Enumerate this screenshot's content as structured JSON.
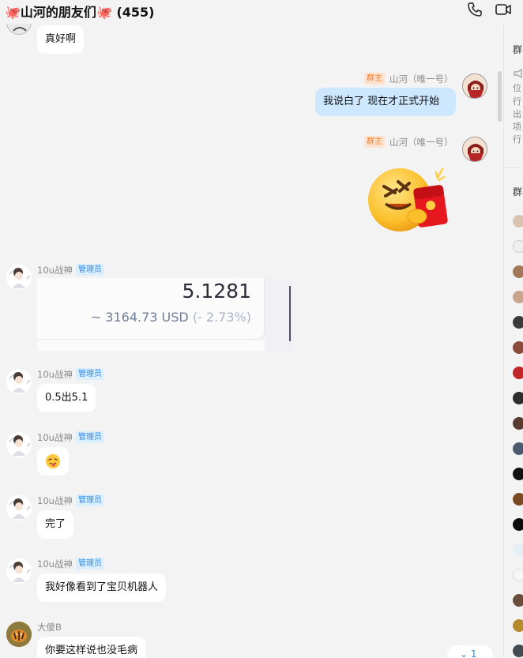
{
  "header": {
    "group_name": "山河的朋友们",
    "member_count": "(455)",
    "call_icon": "phone-icon",
    "video_icon": "video-icon"
  },
  "messages": [
    {
      "type": "text",
      "side": "left",
      "text": "真好啊"
    },
    {
      "type": "text",
      "side": "right",
      "role": "群主",
      "sender": "山河",
      "sender_note": "（唯一号）",
      "text": "我说白了 现在才正式开始"
    },
    {
      "type": "sticker",
      "side": "right",
      "role": "群主",
      "sender": "山河",
      "sender_note": "（唯一号）",
      "sticker": "red-envelope-emoji"
    },
    {
      "type": "price_card",
      "side": "left",
      "role": "管理员",
      "sender": "10u战神",
      "price": "5.1281",
      "usd": "~ 3164.73 USD",
      "change": "(- 2.73%)"
    },
    {
      "type": "text",
      "side": "left",
      "role": "管理员",
      "sender": "10u战神",
      "text": "0.5出5.1"
    },
    {
      "type": "emoji",
      "side": "left",
      "role": "管理员",
      "sender": "10u战神",
      "emoji": "😝"
    },
    {
      "type": "text",
      "side": "left",
      "role": "管理员",
      "sender": "10u战神",
      "text": "完了"
    },
    {
      "type": "text",
      "side": "left",
      "role": "管理员",
      "sender": "10u战神",
      "text": "我好像看到了宝贝机器人"
    },
    {
      "type": "text",
      "side": "left",
      "sender": "大傻B",
      "text": "你要这样说也没毛病"
    }
  ],
  "new_messages": {
    "icon": "double-chevron-down-icon",
    "count": "1"
  },
  "side_panel": {
    "notice_heading": "群",
    "notice_lines": [
      "位",
      "行",
      "出",
      "项",
      "行"
    ],
    "members_heading": "群"
  },
  "colors": {
    "background": "#f3f3f3",
    "self_bubble": "#cde7ff",
    "admin_badge": "#2f8be6",
    "owner_badge": "#f07d2e"
  }
}
